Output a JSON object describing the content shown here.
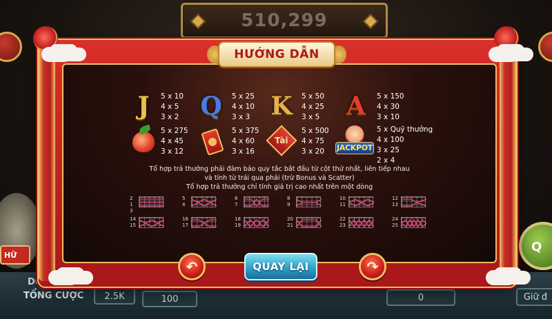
{
  "background": {
    "jackpot_value": "510,299",
    "bottom_left_label_1": "DÒN",
    "bottom_left_label_2": "TỔNG CƯỢC",
    "total_bet": "2.5K",
    "bet_box": "100",
    "win_box": "0",
    "right_label": "Giữ đ",
    "left_tag": "HỮ",
    "ball_label": "Q"
  },
  "dialog": {
    "title": "HƯỚNG DẪN",
    "back_button": "QUAY LẠI",
    "prev_glyph": "↶",
    "next_glyph": "↷"
  },
  "paytable": {
    "row1": [
      {
        "symbol": "J",
        "color": "#e8c24a",
        "pays": [
          "5 x 10",
          "4 x 5",
          "3 x 2"
        ]
      },
      {
        "symbol": "Q",
        "color": "#4a7ae8",
        "pays": [
          "5 x 25",
          "4 x 10",
          "3 x 3"
        ]
      },
      {
        "symbol": "K",
        "color": "#e8b04a",
        "pays": [
          "5 x 50",
          "4 x 25",
          "3 x 5"
        ]
      },
      {
        "symbol": "A",
        "color": "#e83a2a",
        "pays": [
          "5 x 150",
          "4 x 30",
          "3 x 10"
        ]
      }
    ],
    "row2": [
      {
        "symbol": "peach-icon",
        "pays": [
          "5 x 275",
          "4 x 45",
          "3 x 12"
        ]
      },
      {
        "symbol": "red-envelope-icon",
        "pays": [
          "5 x 375",
          "4 x 60",
          "3 x 16"
        ]
      },
      {
        "symbol": "tai-diamond-icon",
        "label": "Tài",
        "pays": [
          "5 x 500",
          "4 x 75",
          "3 x 20"
        ]
      },
      {
        "symbol": "jackpot-icon",
        "label": "JACKPOT",
        "pays": [
          "5 x Quỹ thưởng",
          "4 x 100",
          "3 x 25",
          "2 x 4"
        ]
      }
    ]
  },
  "rules": [
    "Tổ hợp trả thưởng phải đảm bảo quy tắc bắt đầu từ cột thứ nhất, liên tiếp nhau",
    "và tính từ trái qua phải (trừ Bonus và Scatter)",
    "Tổ hợp trả thưởng chỉ tính giá trị cao nhất trên một dòng"
  ],
  "paylines": [
    {
      "nums": [
        "2",
        "1",
        "3"
      ]
    },
    {
      "nums": [
        "5",
        "4"
      ]
    },
    {
      "nums": [
        "6",
        "7"
      ]
    },
    {
      "nums": [
        "8",
        "9"
      ]
    },
    {
      "nums": [
        "10",
        "11"
      ]
    },
    {
      "nums": [
        "12",
        "13"
      ]
    },
    {
      "nums": [
        "14",
        "15"
      ]
    },
    {
      "nums": [
        "16",
        "17"
      ]
    },
    {
      "nums": [
        "18",
        "19"
      ]
    },
    {
      "nums": [
        "20",
        "21"
      ]
    },
    {
      "nums": [
        "22",
        "23"
      ]
    },
    {
      "nums": [
        "24",
        "25"
      ]
    }
  ]
}
